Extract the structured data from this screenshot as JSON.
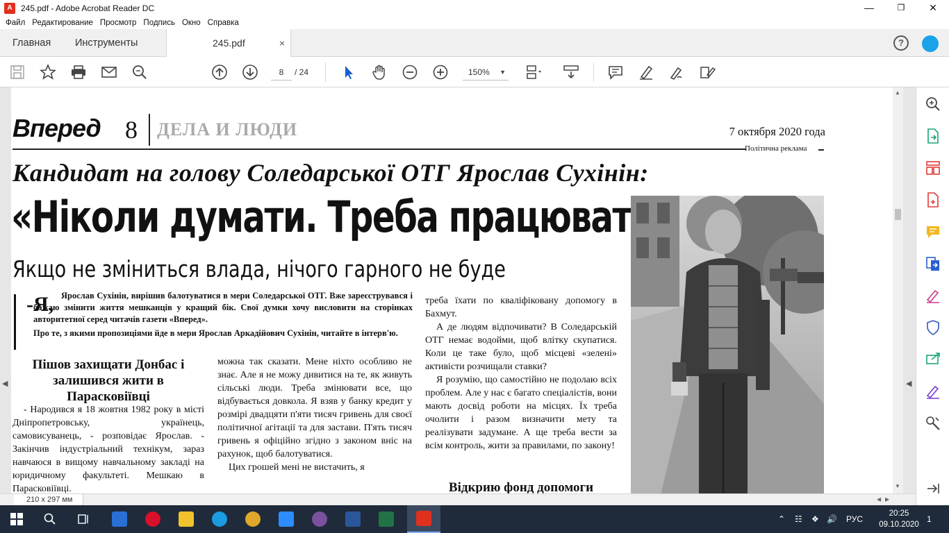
{
  "window": {
    "title": "245.pdf - Adobe Acrobat Reader DC",
    "app_icon_label": "A",
    "minimize": "—",
    "maximize": "❐",
    "close": "✕"
  },
  "menu": [
    "Файл",
    "Редактирование",
    "Просмотр",
    "Подпись",
    "Окно",
    "Справка"
  ],
  "tabs": {
    "home": "Главная",
    "tools": "Инструменты",
    "document": "245.pdf",
    "close_symbol": "×",
    "help_symbol": "?"
  },
  "toolbar": {
    "current_page": "8",
    "total_pages": "/  24",
    "zoom": "150%",
    "zoom_caret": "▼"
  },
  "status": {
    "page_size": "210 x 297 мм"
  },
  "newspaper": {
    "logo": "Вперед",
    "page_number": "8",
    "section": "ДЕЛА И ЛЮДИ",
    "date": "7 октября 2020 года",
    "promo": "Політична реклама",
    "kicker": "Кандидат на голову Соледарської ОТГ Ярослав Сухінін:",
    "headline": "«Ніколи думати. Треба працювати»",
    "subhead": "Якщо не зміниться влада, нічого гарного не буде",
    "lead_dropcap": "-Я,",
    "lead": "Ярослав Сухінін, вирішив балотуватися в мери Соледарської ОТГ. Вже зареєструвався і бажаю змінити життя мешканців у кращий бік. Свої думки хочу висловити на сторінках авторитетної серед читачів газети «Вперед».",
    "lead2": "Про те, з якими пропозиціями йде в мери Ярослав Аркадійович Сухінін, читайте в інтерв'ю.",
    "section_heading": "Пішов захищати Донбас і залишився жити в Парасковіївці",
    "col1": "- Народився я 18 жовтня 1982 року в місті Дніпропетровську, українець, самовисуванець, - розповідає Ярослав. - Закінчив індустріальний технікум, зараз навчаюся в вищому навчальному закладі на юридичному факультеті. Мешкаю в Парасковіївці.",
    "col2_p1": "можна так сказати. Мене ніхто особливо не знає. Але я не можу дивитися на те, як живуть сільські люди. Треба змінювати все, що відбувається довкола. Я взяв у банку кредит у розмірі двадцяти п'яти тисяч гривень для своєї політичної агітації та для застави. П'ять тисяч гривень я офіційно згідно з законом вніс на рахунок, щоб балотуватися.",
    "col2_p2": "Цих грошей мені не вистачить, я",
    "col3_p1": "треба їхати по кваліфіковану допомогу в Бахмут.",
    "col3_p2": "А де людям відпочивати? В Соледарській ОТГ немає водойми, щоб влітку скупатися. Коли це таке було, щоб місцеві «зелені» активісти розчищали ставки?",
    "col3_p3": "Я розумію, що самостійно не подолаю всіх проблем. Але у нас є багато спеціалістів, вони мають досвід роботи на місцях. Їх треба очолити і разом визначити мету та реалізувати задумане. А ще треба вести за всім контроль, жити за правилами, по закону!",
    "col3_heading": "Відкрию фонд допомоги"
  },
  "taskbar": {
    "language": "РУС",
    "time": "20:25",
    "date": "09.10.2020",
    "notifications": "1"
  }
}
